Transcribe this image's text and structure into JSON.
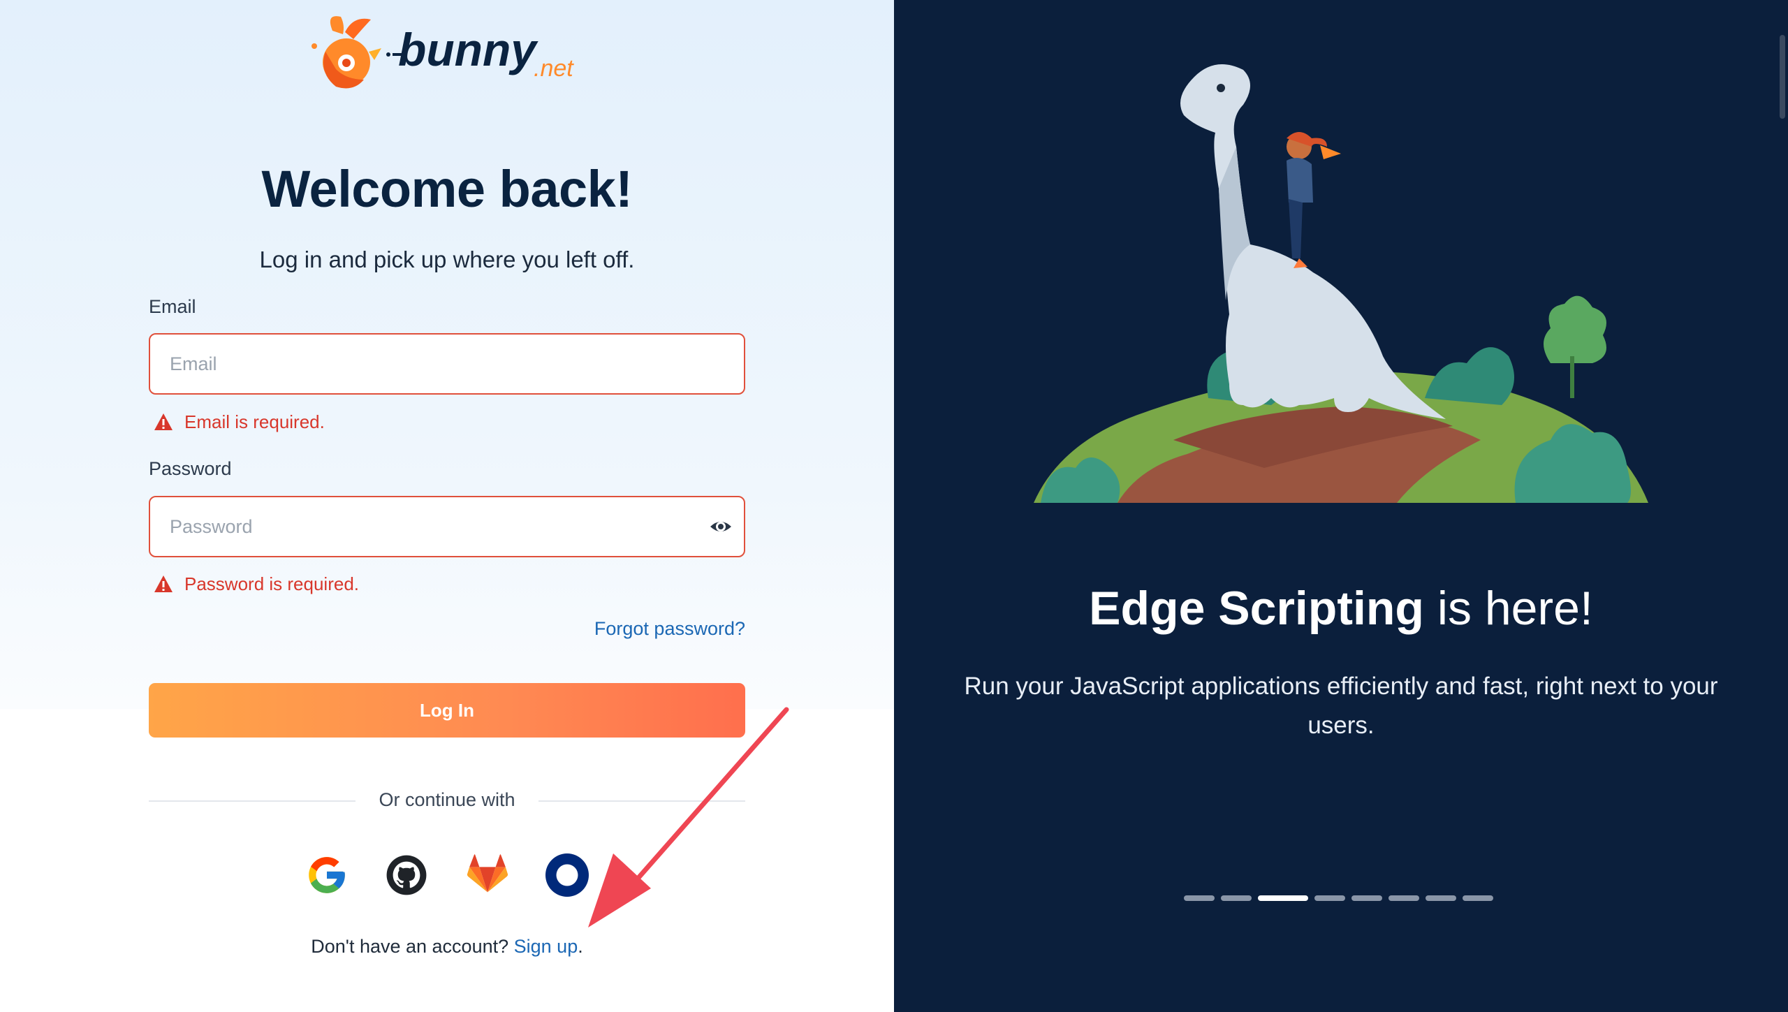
{
  "brand": {
    "name": "bunny",
    "tld": ".net"
  },
  "login": {
    "title": "Welcome back!",
    "subtitle": "Log in and pick up where you left off.",
    "email_label": "Email",
    "email_placeholder": "Email",
    "email_value": "",
    "email_error": "Email is required.",
    "password_label": "Password",
    "password_placeholder": "Password",
    "password_value": "",
    "password_error": "Password is required.",
    "forgot_label": "Forgot password?",
    "submit_label": "Log In",
    "or_continue": "Or continue with",
    "social": [
      "google-icon",
      "github-icon",
      "gitlab-icon",
      "okta-icon"
    ],
    "signup_prompt": "Don't have an account?",
    "signup_link": "Sign up",
    "signup_suffix": "."
  },
  "promo": {
    "headline_bold": "Edge Scripting",
    "headline_rest": " is here!",
    "description": "Run your JavaScript applications efficiently and fast, right next to your users.",
    "slide_count": 8,
    "active_slide": 3
  },
  "colors": {
    "accent_orange": "#ff8a52",
    "error_red": "#d8372b",
    "link_blue": "#1b67b4",
    "navy": "#0b1f3c"
  }
}
